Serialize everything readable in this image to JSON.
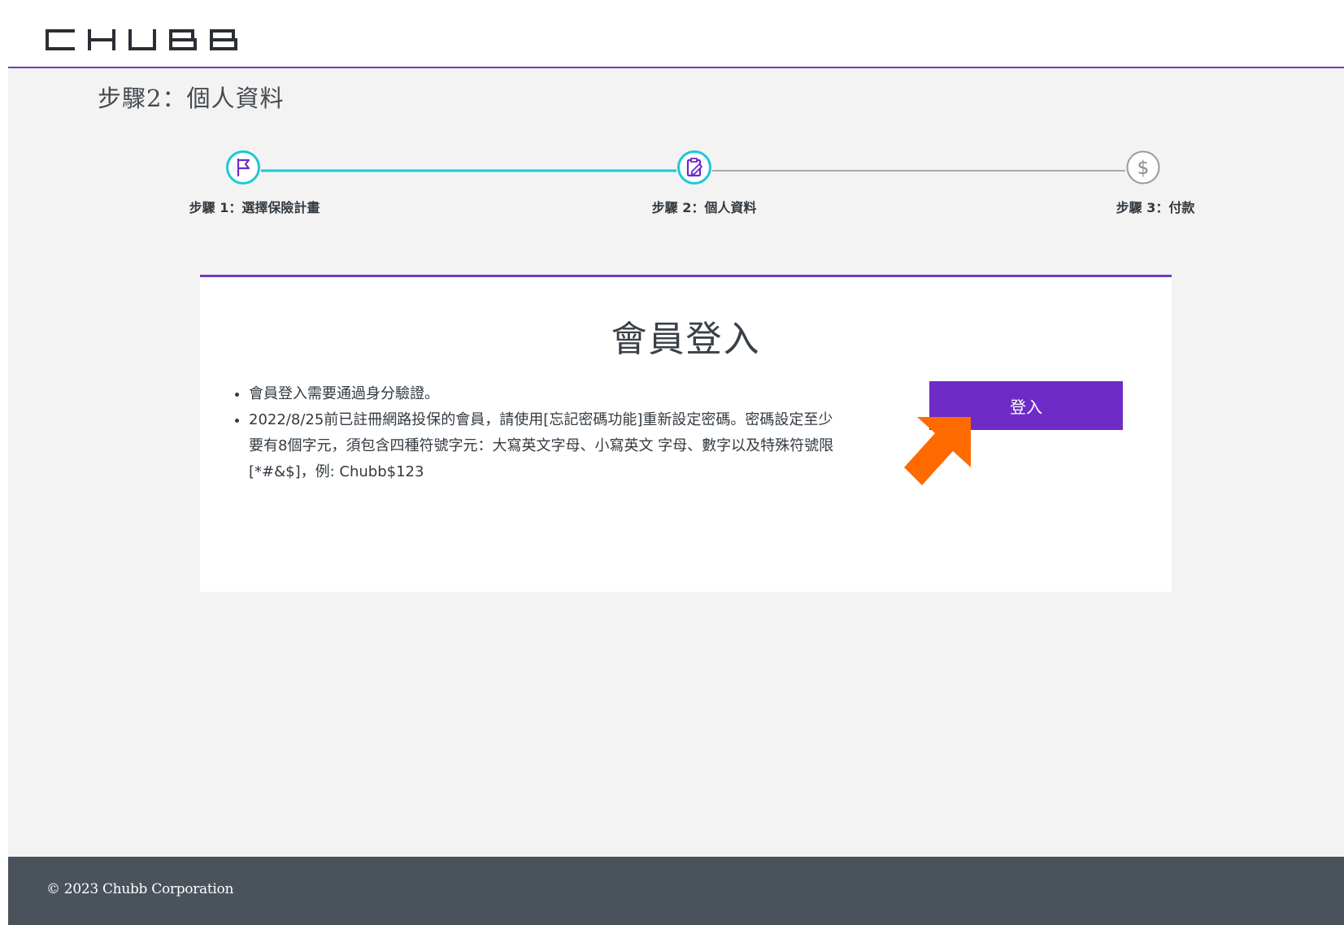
{
  "brand": {
    "name": "CHUBB",
    "accent_color": "#6e3bbf",
    "progress_color": "#1ec8d6"
  },
  "page_title": "步驟2：個人資料",
  "stepper": {
    "steps": [
      {
        "label": "步驟 1：選擇保險計畫",
        "icon": "flag-icon",
        "state": "completed"
      },
      {
        "label": "步驟 2：個人資料",
        "icon": "clipboard-icon",
        "state": "current"
      },
      {
        "label": "步驟 3：付款",
        "icon": "dollar-icon",
        "state": "pending"
      }
    ]
  },
  "login_card": {
    "title": "會員登入",
    "notes": [
      "會員登入需要通過身分驗證。",
      "2022/8/25前已註冊網路投保的會員，請使用[忘記密碼功能]重新設定密碼。密碼設定至少要有8個字元，須包含四種符號字元：大寫英文字母、小寫英文 字母、數字以及特殊符號限[*#&$]，例: Chubb$123"
    ],
    "login_button_label": "登入",
    "login_button_color": "#6e2bc6"
  },
  "annotation": {
    "icon": "arrow-pointer-icon",
    "color": "#ff6a00"
  },
  "footer": {
    "copyright": "© 2023 Chubb Corporation"
  }
}
